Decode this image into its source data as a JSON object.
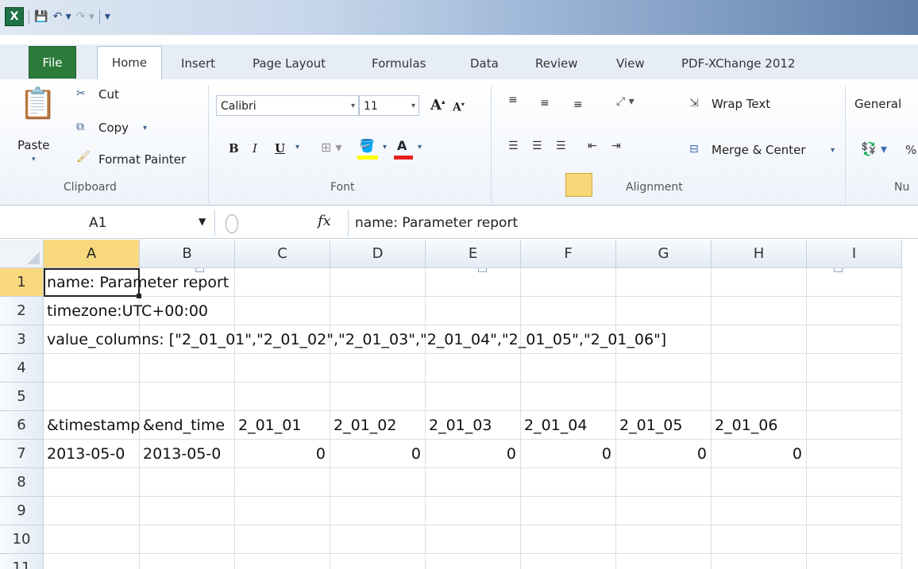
{
  "qat": {
    "app_icon": "X",
    "save_icon": "save-icon",
    "undo_icon": "undo-icon",
    "redo_icon": "redo-icon"
  },
  "tabs": [
    "File",
    "Home",
    "Insert",
    "Page Layout",
    "Formulas",
    "Data",
    "Review",
    "View",
    "PDF-XChange 2012"
  ],
  "ribbon": {
    "clipboard": {
      "paste": "Paste",
      "cut": "Cut",
      "copy": "Copy",
      "format_painter": "Format Painter",
      "label": "Clipboard"
    },
    "font": {
      "name": "Calibri",
      "size": "11",
      "bold": "B",
      "italic": "I",
      "underline": "U",
      "label": "Font"
    },
    "alignment": {
      "wrap_text": "Wrap Text",
      "merge_center": "Merge & Center",
      "label": "Alignment"
    },
    "number": {
      "format": "General",
      "percent": "%",
      "label": "Nu"
    }
  },
  "formula_bar": {
    "name_box": "A1",
    "fx": "fx",
    "formula": "name: Parameter report"
  },
  "columns": [
    "A",
    "B",
    "C",
    "D",
    "E",
    "F",
    "G",
    "H",
    "I"
  ],
  "rows": [
    "1",
    "2",
    "3",
    "4",
    "5",
    "6",
    "7",
    "8",
    "9",
    "10",
    "11"
  ],
  "cells": {
    "r1": "name: Parameter report",
    "r2": "timezone:UTC+00:00",
    "r3": "value_columns: [\"2_01_01\",\"2_01_02\",\"2_01_03\",\"2_01_04\",\"2_01_05\",\"2_01_06\"]",
    "r6": [
      "&timestamp",
      "&end_time",
      "2_01_01",
      "2_01_02",
      "2_01_03",
      "2_01_04",
      "2_01_05",
      "2_01_06"
    ],
    "r7": [
      "2013-05-0",
      "2013-05-0",
      "0",
      "0",
      "0",
      "0",
      "0",
      "0"
    ]
  },
  "colors": {
    "file_tab": "#2c7b3b",
    "selected_header": "#f9d97e"
  }
}
